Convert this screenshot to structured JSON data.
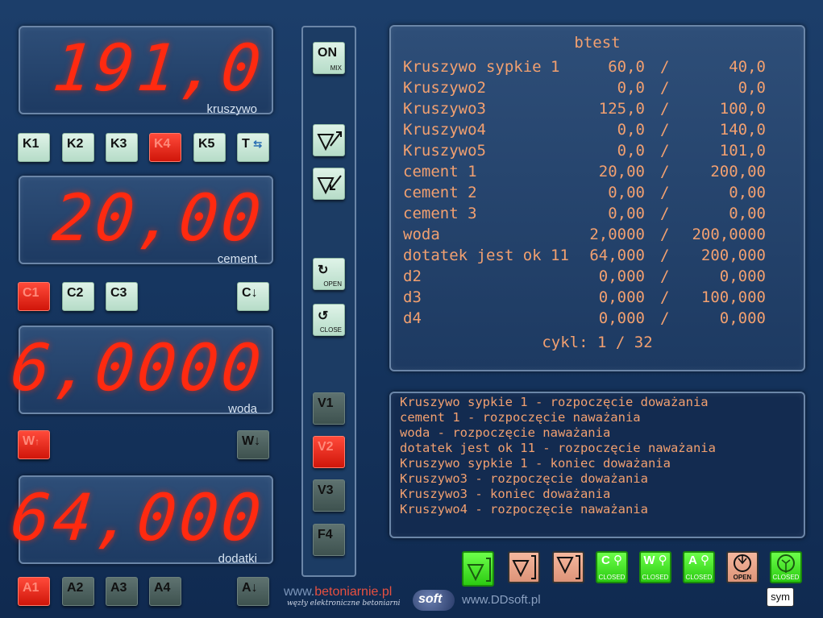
{
  "displays": [
    {
      "value": "191,0",
      "label": "kruszywo"
    },
    {
      "value": "20,00",
      "label": "cement"
    },
    {
      "value": "6,0000",
      "label": "woda"
    },
    {
      "value": "64,000",
      "label": "dodatki"
    }
  ],
  "k_buttons": [
    "K1",
    "K2",
    "K3",
    "K4",
    "K5",
    "T"
  ],
  "c_buttons": [
    "C1",
    "C2",
    "C3",
    "C"
  ],
  "w_buttons": [
    "W",
    "W"
  ],
  "a_buttons": [
    "A1",
    "A2",
    "A3",
    "A4",
    "A"
  ],
  "vbar": {
    "on": "ON",
    "mix": "MIX",
    "open": "OPEN",
    "close": "CLOSE",
    "v1": "V1",
    "v2": "V2",
    "v3": "V3",
    "f4": "F4"
  },
  "recipe": {
    "title": "btest",
    "rows": [
      {
        "name": "Kruszywo sypkie 1",
        "actual": "60,0",
        "target": "40,0"
      },
      {
        "name": "Kruszywo2",
        "actual": "0,0",
        "target": "0,0"
      },
      {
        "name": "Kruszywo3",
        "actual": "125,0",
        "target": "100,0"
      },
      {
        "name": "Kruszywo4",
        "actual": "0,0",
        "target": "140,0"
      },
      {
        "name": "Kruszywo5",
        "actual": "0,0",
        "target": "101,0"
      },
      {
        "name": "cement 1",
        "actual": "20,00",
        "target": "200,00"
      },
      {
        "name": "cement 2",
        "actual": "0,00",
        "target": "0,00"
      },
      {
        "name": "cement 3",
        "actual": "0,00",
        "target": "0,00"
      },
      {
        "name": "woda",
        "actual": "2,0000",
        "target": "200,0000"
      },
      {
        "name": "dotatek jest ok 11",
        "actual": "64,000",
        "target": "200,000"
      },
      {
        "name": "d2",
        "actual": "0,000",
        "target": "0,000"
      },
      {
        "name": "d3",
        "actual": "0,000",
        "target": "100,000"
      },
      {
        "name": "d4",
        "actual": "0,000",
        "target": "0,000"
      }
    ],
    "cycle": "cykl: 1 / 32"
  },
  "log": [
    "Kruszywo sypkie 1 - rozpoczęcie doważania",
    "cement 1 - rozpoczęcie naważania",
    "woda - rozpoczęcie naważania",
    "dotatek jest ok 11 - rozpoczęcie naważania",
    "Kruszywo sypkie 1 - koniec doważania",
    "Kruszywo3 - rozpoczęcie doważania",
    "Kruszywo3 - koniec doważania",
    "Kruszywo4 - rozpoczęcie naważania"
  ],
  "status_buttons": {
    "c": "C",
    "w": "W",
    "a": "A",
    "closed": "CLOSED",
    "open": "OPEN"
  },
  "footer": {
    "www": "www.",
    "betoniarnie": "betoniarnie.pl",
    "tagline": "węzły elektroniczne betoniarni",
    "soft": "soft",
    "ddsoft": "www.DDsoft.pl",
    "sym": "sym"
  },
  "colors": {
    "display_red": "#ff2a10",
    "mint": "#c8e8d6",
    "active_red": "#e8281a",
    "green": "#3ee020",
    "salmon": "#e8a488",
    "text_orange": "#f2a070"
  }
}
